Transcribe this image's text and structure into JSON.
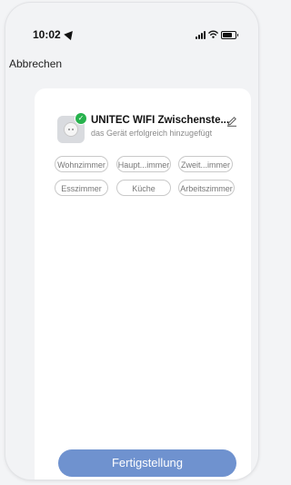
{
  "status_bar": {
    "time": "10:02"
  },
  "header": {
    "cancel_label": "Abbrechen"
  },
  "device": {
    "name": "UNITEC WIFI Zwischenste...",
    "status": "das Gerät erfolgreich hinzugefügt"
  },
  "rooms": [
    {
      "label": "Wohnzimmer"
    },
    {
      "label": "Haupt...immer"
    },
    {
      "label": "Zweit...immer"
    },
    {
      "label": "Esszimmer"
    },
    {
      "label": "Küche"
    },
    {
      "label": "Arbeitszimmer"
    }
  ],
  "footer": {
    "done_label": "Fertigstellung"
  },
  "colors": {
    "primary_button": "#6f92cf",
    "success_check": "#27b24d"
  },
  "icons": [
    "location-arrow-icon",
    "signal-icon",
    "wifi-icon",
    "battery-icon",
    "smart-plug-icon",
    "checkmark-icon",
    "edit-pencil-icon"
  ]
}
